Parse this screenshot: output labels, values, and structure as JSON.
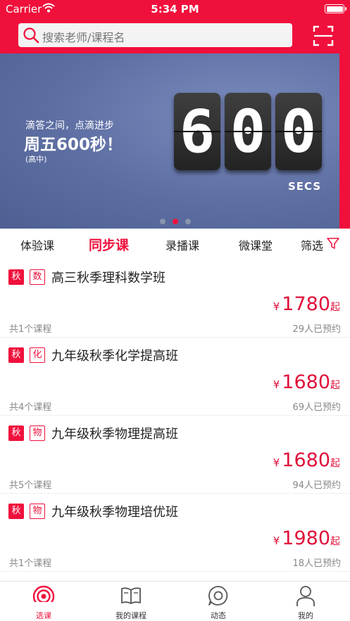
{
  "status_bar": {
    "carrier": "Carrier",
    "time": "5:34 PM"
  },
  "search": {
    "placeholder": "搜索老师/课程名"
  },
  "banner": {
    "subtitle": "滴答之间，点滴进步",
    "headline": "周五600秒！",
    "level": "(高中)",
    "digits": [
      "6",
      "0",
      "0"
    ],
    "unit": "SECS",
    "active_dot": 1
  },
  "tabs": [
    {
      "label": "体验课",
      "active": false
    },
    {
      "label": "同步课",
      "active": true
    },
    {
      "label": "录播课",
      "active": false
    },
    {
      "label": "微课堂",
      "active": false
    }
  ],
  "filter_label": "筛选",
  "courses": [
    {
      "season": "秋",
      "subject": "数",
      "name": "高三秋季理科数学班",
      "currency": "¥",
      "price": "1780",
      "suffix": "起",
      "count": "共1个课程",
      "booked": "29人已预约"
    },
    {
      "season": "秋",
      "subject": "化",
      "name": "九年级秋季化学提高班",
      "currency": "¥",
      "price": "1680",
      "suffix": "起",
      "count": "共4个课程",
      "booked": "69人已预约"
    },
    {
      "season": "秋",
      "subject": "物",
      "name": "九年级秋季物理提高班",
      "currency": "¥",
      "price": "1680",
      "suffix": "起",
      "count": "共5个课程",
      "booked": "94人已预约"
    },
    {
      "season": "秋",
      "subject": "物",
      "name": "九年级秋季物理培优班",
      "currency": "¥",
      "price": "1980",
      "suffix": "起",
      "count": "共1个课程",
      "booked": "18人已预约"
    }
  ],
  "bottom_nav": [
    {
      "label": "选课",
      "icon": "broadcast-icon",
      "active": true
    },
    {
      "label": "我的课程",
      "icon": "book-icon",
      "active": false
    },
    {
      "label": "动态",
      "icon": "chat-icon",
      "active": false
    },
    {
      "label": "我的",
      "icon": "user-icon",
      "active": false
    }
  ],
  "colors": {
    "brand": "#f0103c",
    "banner_bg": "#6475a7",
    "muted_text": "#888888"
  }
}
